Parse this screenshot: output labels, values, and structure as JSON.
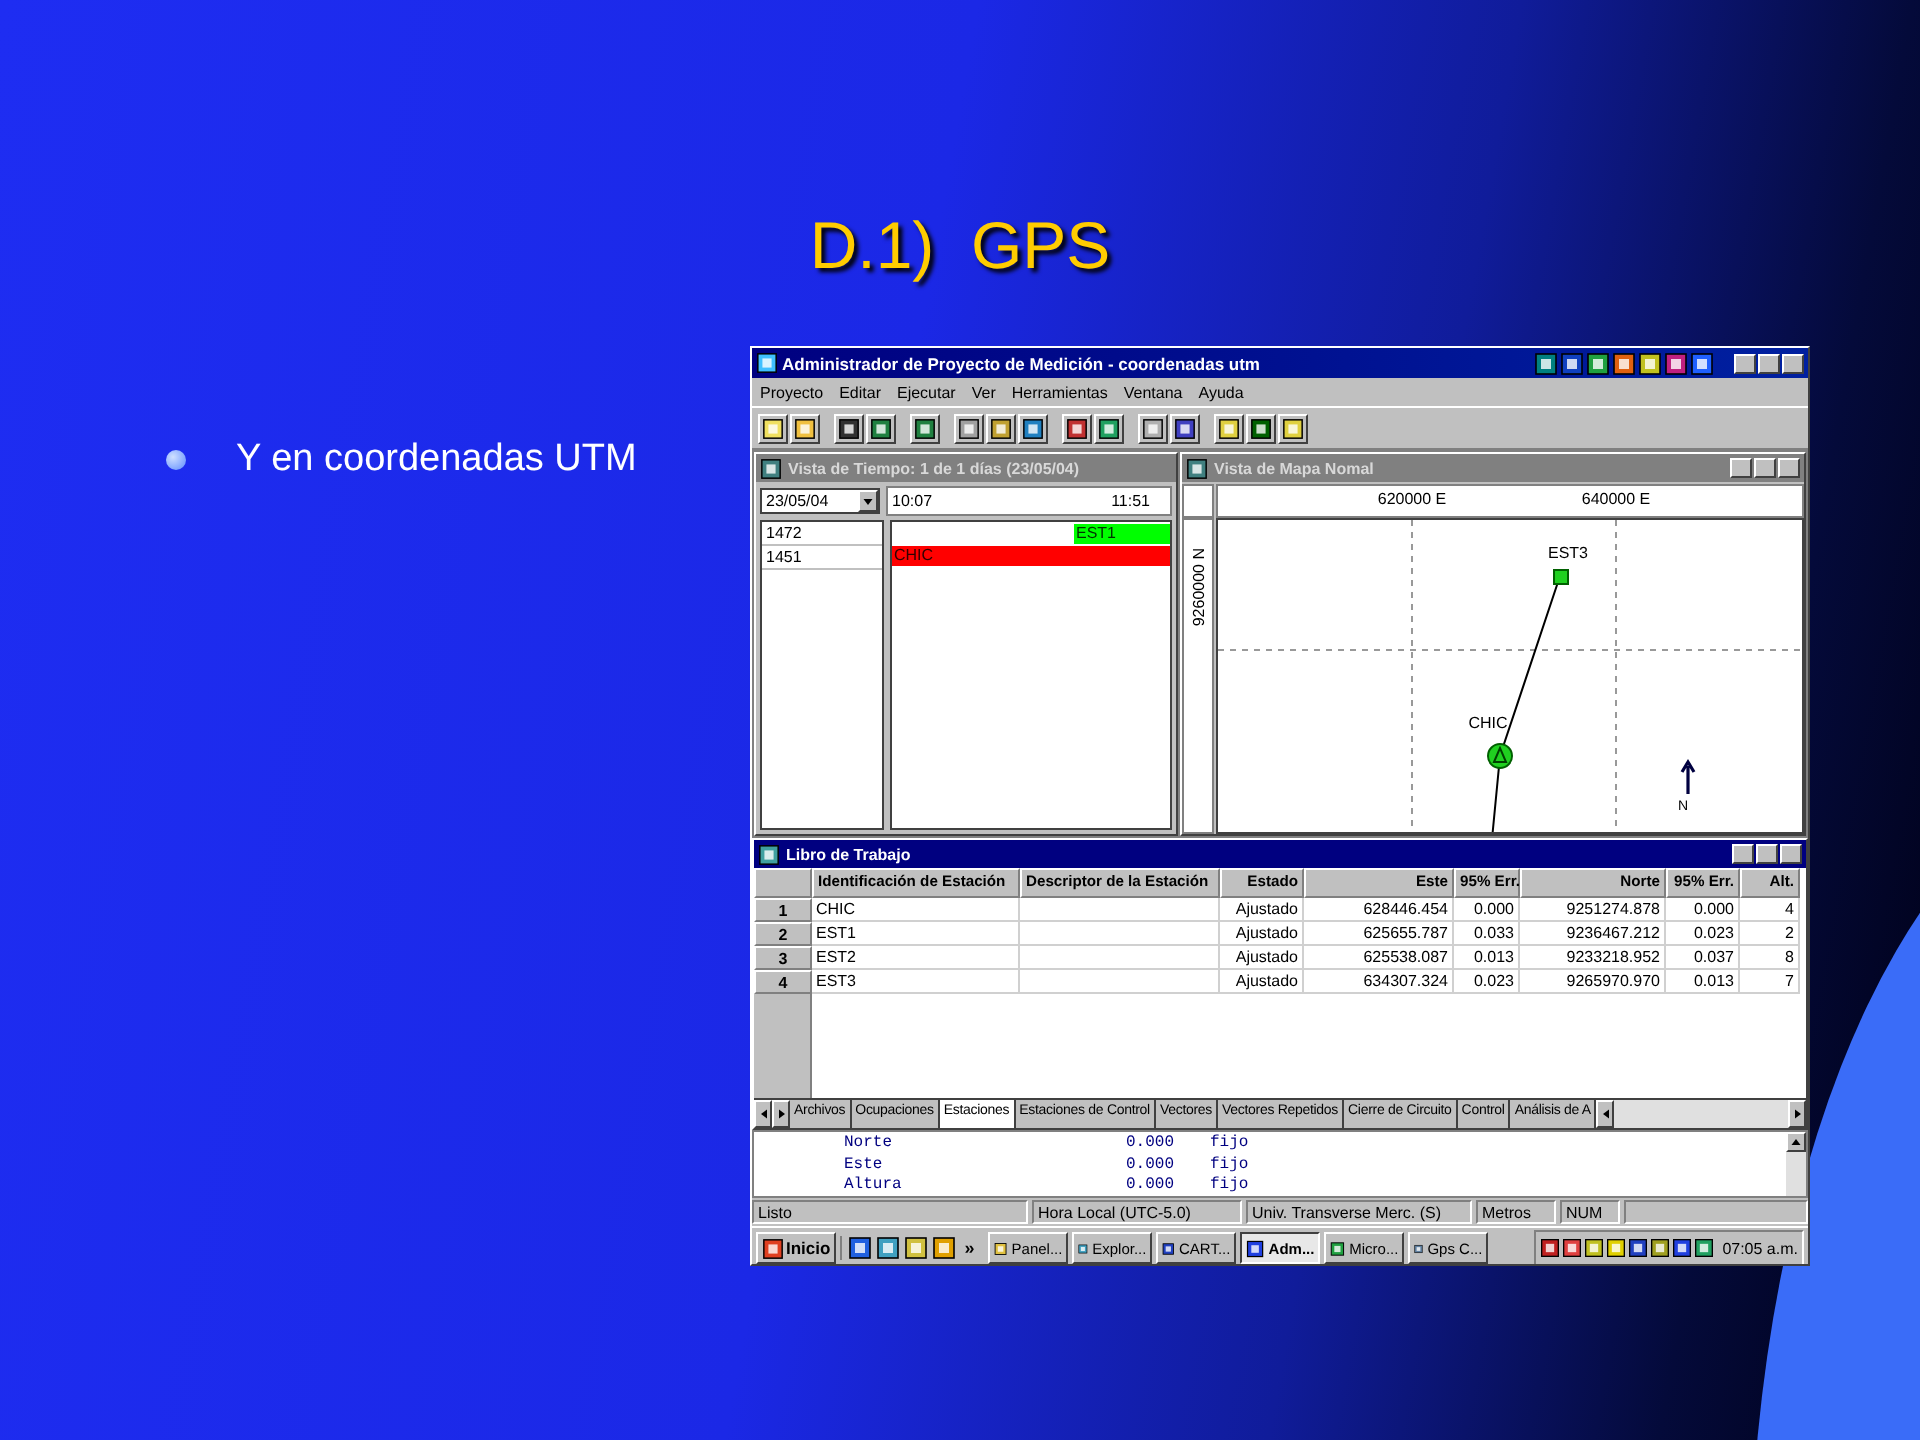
{
  "slide": {
    "title": "D.1)  GPS",
    "bullets": [
      "Y en coordenadas UTM"
    ]
  },
  "app": {
    "title": "Administrador de Proyecto de Medición - coordenadas utm",
    "menu": [
      "Proyecto",
      "Editar",
      "Ejecutar",
      "Ver",
      "Herramientas",
      "Ventana",
      "Ayuda"
    ],
    "time_view": {
      "title": "Vista de Tiempo: 1 de 1 días (23/05/04)",
      "date": "23/05/04",
      "start": "10:07",
      "end": "11:51",
      "rows": [
        {
          "label": "1472",
          "bar": "EST1",
          "kind": "partial",
          "color": "#00ff00"
        },
        {
          "label": "1451",
          "bar": "CHIC",
          "kind": "full",
          "color": "#ff0000"
        }
      ]
    },
    "map_view": {
      "title": "Vista de Mapa Nomal",
      "x_labels": [
        "620000 E",
        "640000 E"
      ],
      "y_label": "9260000 N",
      "north": "N",
      "stations": [
        {
          "name": "EST3",
          "kind": "square"
        },
        {
          "name": "CHIC",
          "kind": "circle"
        }
      ]
    },
    "workbook": {
      "title": "Libro de Trabajo",
      "columns": [
        "Identificación de Estación",
        "Descriptor de la Estación",
        "Estado",
        "Este",
        "95% Err.",
        "Norte",
        "95% Err.",
        "Alt."
      ],
      "rows": [
        {
          "number": "1",
          "id": "CHIC",
          "status": "Ajustado",
          "este": "628446.454",
          "este_err": "0.000",
          "norte": "9251274.878",
          "norte_err": "0.000",
          "alt": "4"
        },
        {
          "number": "2",
          "id": "EST1",
          "status": "Ajustado",
          "este": "625655.787",
          "este_err": "0.033",
          "norte": "9236467.212",
          "norte_err": "0.023",
          "alt": "2"
        },
        {
          "number": "3",
          "id": "EST2",
          "status": "Ajustado",
          "este": "625538.087",
          "este_err": "0.013",
          "norte": "9233218.952",
          "norte_err": "0.037",
          "alt": "8"
        },
        {
          "number": "4",
          "id": "EST3",
          "status": "Ajustado",
          "este": "634307.324",
          "este_err": "0.023",
          "norte": "9265970.970",
          "norte_err": "0.013",
          "alt": "7"
        }
      ],
      "tabs": [
        {
          "label": "Archivos",
          "selected": false
        },
        {
          "label": "Ocupaciones",
          "selected": false
        },
        {
          "label": "Estaciones",
          "selected": true
        },
        {
          "label": "Estaciones de Control",
          "selected": false
        },
        {
          "label": "Vectores",
          "selected": false
        },
        {
          "label": "Vectores Repetidos",
          "selected": false
        },
        {
          "label": "Cierre de Circuito",
          "selected": false
        },
        {
          "label": "Control",
          "selected": false
        },
        {
          "label": "Análisis de A",
          "selected": false
        }
      ],
      "details": [
        {
          "name": "Norte",
          "value": "0.000",
          "mode": "fijo"
        },
        {
          "name": "Este",
          "value": "0.000",
          "mode": "fijo"
        },
        {
          "name": "Altura",
          "value": "0.000",
          "mode": "fijo"
        }
      ]
    },
    "status_bar": [
      "Listo",
      "Hora Local (UTC-5.0)",
      "Univ. Transverse Merc. (S)",
      "Metros",
      "NUM"
    ],
    "taskbar": {
      "start": "Inicio",
      "more": "»",
      "clock": "07:05 a.m.",
      "tasks": [
        {
          "label": "Panel...",
          "selected": false
        },
        {
          "label": "Explor...",
          "selected": false
        },
        {
          "label": "CART...",
          "selected": false
        },
        {
          "label": "Adm...",
          "selected": true
        },
        {
          "label": "Micro...",
          "selected": false
        },
        {
          "label": "Gps C...",
          "selected": false
        }
      ]
    }
  }
}
